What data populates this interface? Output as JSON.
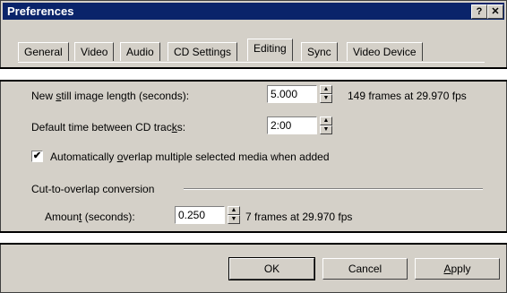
{
  "window": {
    "title": "Preferences",
    "help_label": "?",
    "close_label": "✕"
  },
  "tabs": [
    {
      "label": "General"
    },
    {
      "label": "Video"
    },
    {
      "label": "Audio"
    },
    {
      "label": "CD Settings"
    },
    {
      "label": "Editing",
      "active": true
    },
    {
      "label": "Sync"
    },
    {
      "label": "Video Device"
    }
  ],
  "editing": {
    "still_length": {
      "label_pre": "New ",
      "label_u": "s",
      "label_post": "till image length (seconds):",
      "value": "5.000",
      "info": "149 frames at 29.970 fps"
    },
    "cd_gap": {
      "label_pre": "Default time between CD trac",
      "label_u": "k",
      "label_post": "s:",
      "value": "2:00"
    },
    "auto_overlap": {
      "checked": true,
      "label_pre": "Automatically ",
      "label_u": "o",
      "label_post": "verlap multiple selected media when added"
    },
    "cut_group": {
      "label": "Cut-to-overlap conversion"
    },
    "amount": {
      "label_pre": "Amoun",
      "label_u": "t",
      "label_post": " (seconds):",
      "value": "0.250",
      "info": "7 frames at 29.970 fps"
    }
  },
  "buttons": {
    "ok": "OK",
    "cancel": "Cancel",
    "apply_u": "A",
    "apply_rest": "pply"
  },
  "colors": {
    "titlebar": "#0a246a",
    "face": "#d4d0c8"
  },
  "icons": {
    "spin_up": "▲",
    "spin_down": "▼",
    "check": "✔"
  }
}
